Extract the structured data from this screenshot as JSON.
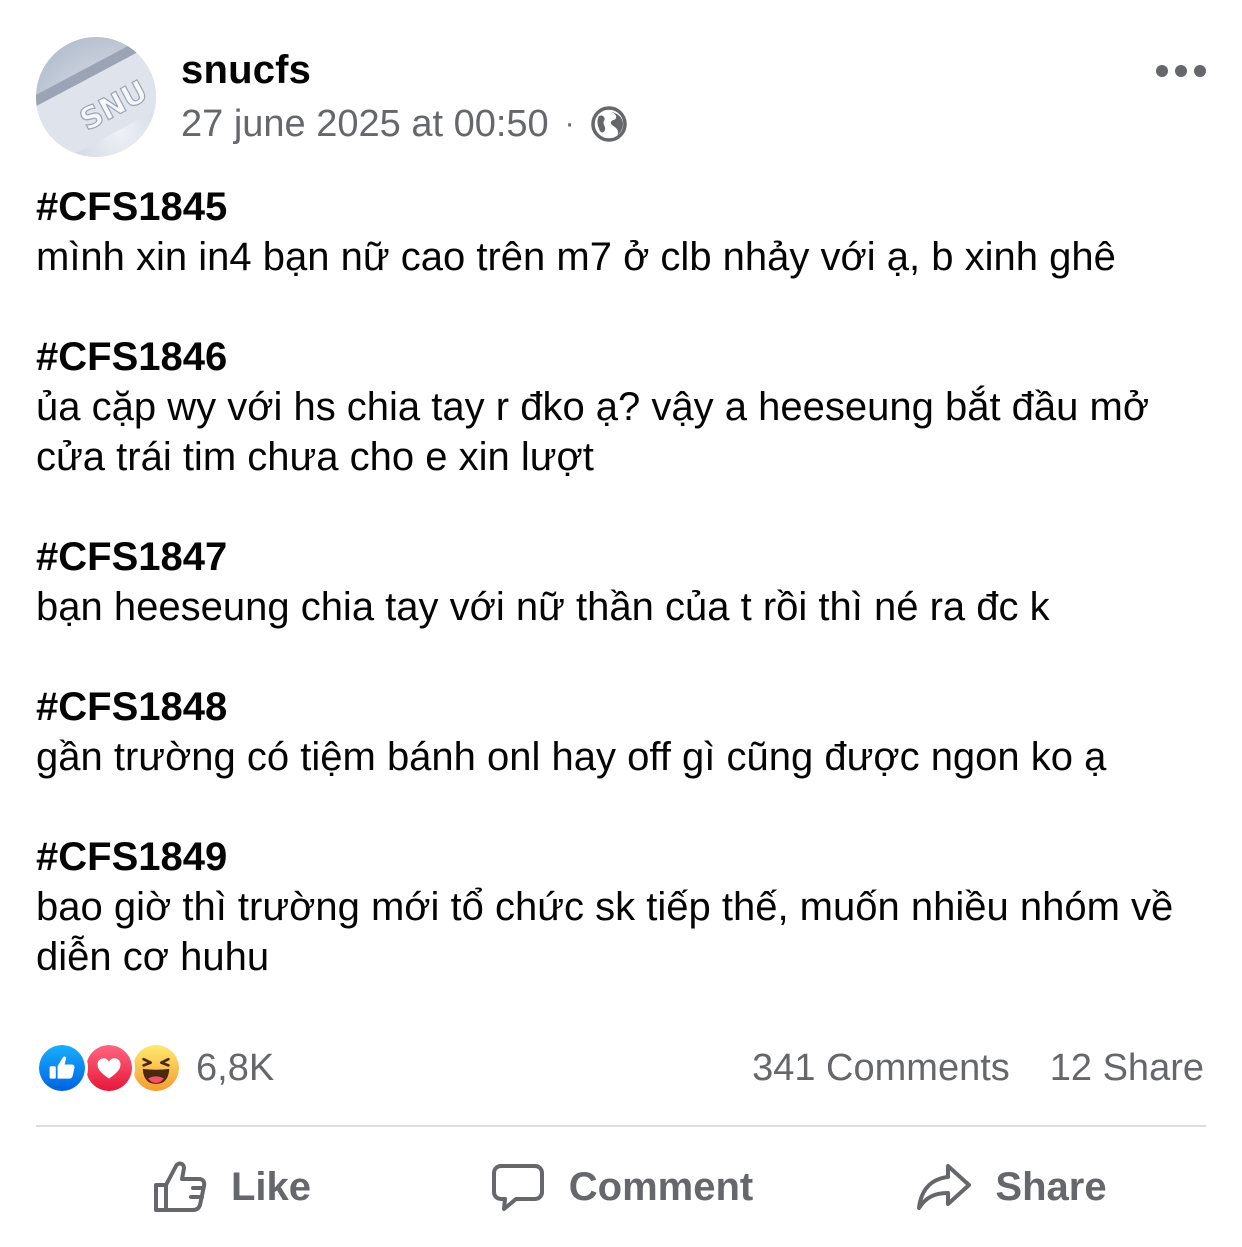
{
  "header": {
    "author": "snucfs",
    "timestamp": "27 june 2025 at 00:50",
    "separator": "·",
    "audience_icon": "globe-icon",
    "avatar_text": "SNU",
    "more_icon": "more-options-icon"
  },
  "entries": [
    {
      "tag": "#CFS1845",
      "text": "mình xin in4 bạn nữ cao trên m7 ở clb nhảy với ạ, b xinh ghê"
    },
    {
      "tag": "#CFS1846",
      "text": "ủa cặp wy với hs chia tay r đko ạ? vậy a heeseung bắt đầu mở cửa trái tim chưa cho e xin lượt"
    },
    {
      "tag": "#CFS1847",
      "text": "bạn heeseung chia tay với nữ thần của t rồi thì né ra đc k"
    },
    {
      "tag": "#CFS1848",
      "text": "gần trường có tiệm bánh onl hay off gì cũng được ngon ko ạ"
    },
    {
      "tag": "#CFS1849",
      "text": "bao giờ thì trường mới tổ chức sk tiếp thế, muốn nhiều nhóm về diễn cơ huhu"
    }
  ],
  "reactions": {
    "icons": [
      "like-reaction-icon",
      "love-reaction-icon",
      "haha-reaction-icon"
    ],
    "count": "6,8K"
  },
  "counts": {
    "comments": "341 Comments",
    "shares": "12 Share"
  },
  "actions": {
    "like": "Like",
    "comment": "Comment",
    "share": "Share"
  },
  "colors": {
    "text_primary": "#050505",
    "text_secondary": "#65676b",
    "divider": "#dadde1",
    "like_blue": "#1877f2",
    "love_red": "#f33e58",
    "haha_yellow": "#f7b928"
  }
}
